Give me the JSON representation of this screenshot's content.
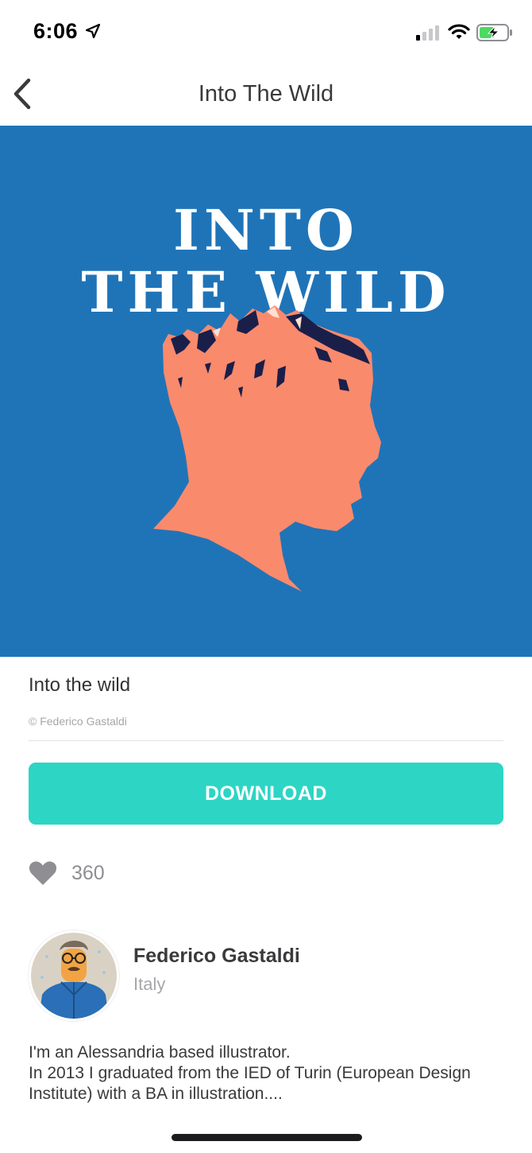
{
  "status_bar": {
    "time": "6:06",
    "icons": [
      "location-arrow-icon",
      "cellular-signal-icon",
      "wifi-icon",
      "battery-charging-icon"
    ]
  },
  "nav": {
    "title": "Into The Wild",
    "back_icon": "chevron-left-icon"
  },
  "artwork": {
    "line1": "INTO",
    "line2": "THE WILD",
    "colors": {
      "background": "#1f74b8",
      "silhouette": "#fa8a6c",
      "mountain_shadow": "#1a1f4a"
    }
  },
  "work": {
    "title": "Into the wild",
    "copyright": "© Federico Gastaldi"
  },
  "download": {
    "label": "DOWNLOAD",
    "color": "#2dd5c4"
  },
  "likes": {
    "icon": "heart-icon",
    "count": "360"
  },
  "author": {
    "name": "Federico Gastaldi",
    "country": "Italy",
    "bio_line1": "I'm an Alessandria based illustrator.",
    "bio_line2": "In 2013 I graduated from the IED of Turin (European Design Institute) with a BA in illustration...."
  }
}
